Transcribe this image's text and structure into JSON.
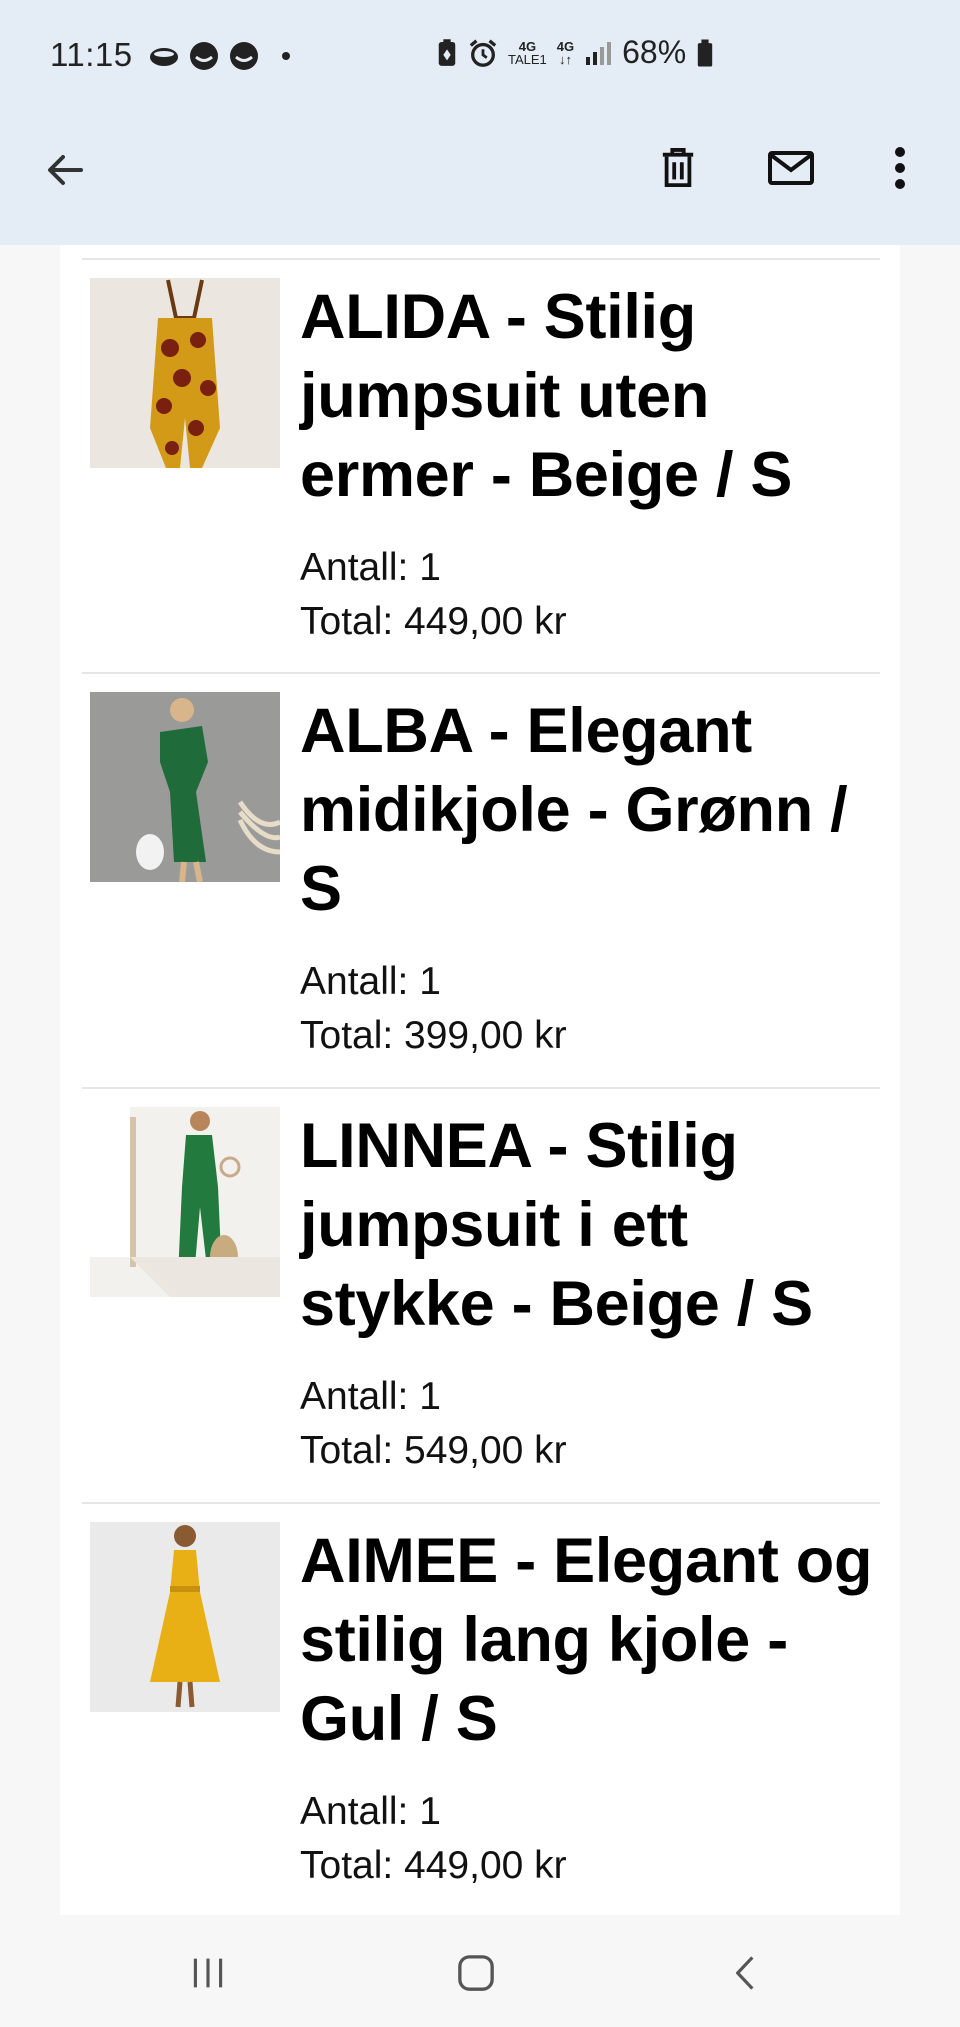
{
  "status_bar": {
    "time": "11:15",
    "net1_top": "4G",
    "net1_bottom": "TALE1",
    "net2_top": "4G",
    "net2_bottom": "↓↑",
    "battery": "68%",
    "icons": [
      "cloud-icon",
      "face-icon",
      "face-icon",
      "dot-icon",
      "battery-saver-icon",
      "alarm-icon",
      "signal-icon",
      "battery-icon"
    ]
  },
  "app_bar": {
    "icons": [
      "back-arrow-icon",
      "trash-icon",
      "mail-icon",
      "more-vert-icon"
    ]
  },
  "items": [
    {
      "title": "ALIDA - Stilig jumpsuit uten ermer - Beige / S",
      "qty": "Antall: 1",
      "total": "Total: 449,00 kr",
      "image": "sunflower-jumpsuit"
    },
    {
      "title": "ALBA - Elegant midikjole - Grønn / S",
      "qty": "Antall: 1",
      "total": "Total: 399,00 kr",
      "image": "green-midi-dress"
    },
    {
      "title": "LINNEA - Stilig jumpsuit i ett stykke - Beige / S",
      "qty": "Antall: 1",
      "total": "Total: 549,00 kr",
      "image": "green-jumpsuit"
    },
    {
      "title": "AIMEE - Elegant og stilig lang kjole - Gul / S",
      "qty": "Antall: 1",
      "total": "Total: 449,00 kr",
      "image": "yellow-long-dress"
    }
  ],
  "nav_bar": {
    "icons": [
      "recent-apps-icon",
      "home-icon",
      "back-icon"
    ]
  },
  "colors": {
    "header_bg": "#e4ecf6",
    "page_bg": "#f7f7f7",
    "card_bg": "#ffffff",
    "divider": "#e6e6e6"
  }
}
